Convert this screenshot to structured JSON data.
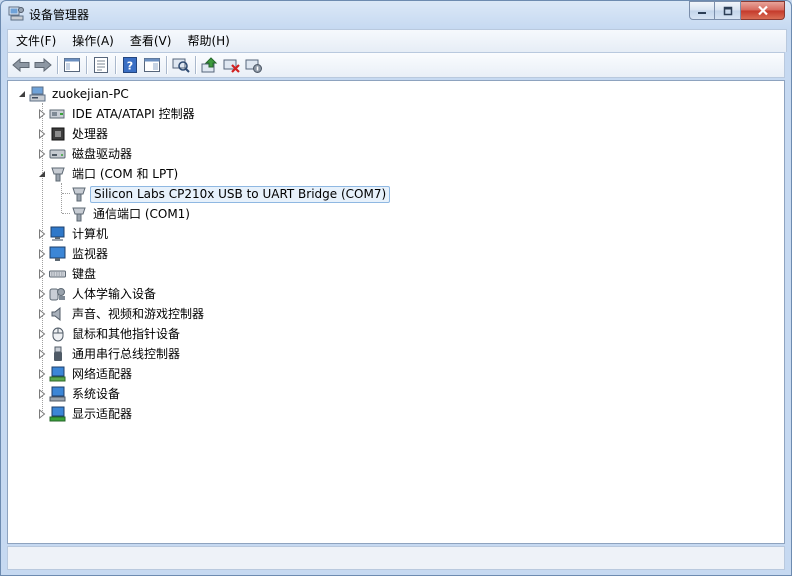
{
  "window": {
    "title": "设备管理器",
    "icon": "device-manager-icon"
  },
  "menu": [
    {
      "label": "文件(F)"
    },
    {
      "label": "操作(A)"
    },
    {
      "label": "查看(V)"
    },
    {
      "label": "帮助(H)"
    }
  ],
  "toolbar": [
    {
      "name": "back-icon"
    },
    {
      "name": "forward-icon"
    },
    {
      "name": "show-hide-console-tree-icon"
    },
    {
      "name": "properties-icon"
    },
    {
      "name": "help-icon"
    },
    {
      "name": "action-pane-icon"
    },
    {
      "name": "scan-hardware-icon"
    },
    {
      "name": "update-driver-icon"
    },
    {
      "name": "uninstall-icon"
    },
    {
      "name": "disable-device-icon"
    }
  ],
  "tree": {
    "root": "zuokejian-PC",
    "categories": [
      {
        "label": "IDE ATA/ATAPI 控制器",
        "icon": "ide-controller-icon",
        "expanded": false
      },
      {
        "label": "处理器",
        "icon": "processor-icon",
        "expanded": false
      },
      {
        "label": "磁盘驱动器",
        "icon": "disk-drive-icon",
        "expanded": false
      },
      {
        "label": "端口 (COM 和 LPT)",
        "icon": "port-icon",
        "expanded": true,
        "children": [
          {
            "label": "Silicon Labs CP210x USB to UART Bridge (COM7)",
            "icon": "port-icon",
            "selected": true
          },
          {
            "label": "通信端口 (COM1)",
            "icon": "port-icon",
            "selected": false
          }
        ]
      },
      {
        "label": "计算机",
        "icon": "computer-icon",
        "expanded": false
      },
      {
        "label": "监视器",
        "icon": "monitor-icon",
        "expanded": false
      },
      {
        "label": "键盘",
        "icon": "keyboard-icon",
        "expanded": false
      },
      {
        "label": "人体学输入设备",
        "icon": "hid-icon",
        "expanded": false
      },
      {
        "label": "声音、视频和游戏控制器",
        "icon": "sound-icon",
        "expanded": false
      },
      {
        "label": "鼠标和其他指针设备",
        "icon": "mouse-icon",
        "expanded": false
      },
      {
        "label": "通用串行总线控制器",
        "icon": "usb-icon",
        "expanded": false
      },
      {
        "label": "网络适配器",
        "icon": "network-adapter-icon",
        "expanded": false
      },
      {
        "label": "系统设备",
        "icon": "system-device-icon",
        "expanded": false
      },
      {
        "label": "显示适配器",
        "icon": "display-adapter-icon",
        "expanded": false
      }
    ]
  },
  "colors": {
    "selection_bg": "#e7f1fb",
    "selection_border": "#8fb8e2",
    "close_button": "#c4392a",
    "chrome": "#c6d9f1"
  }
}
